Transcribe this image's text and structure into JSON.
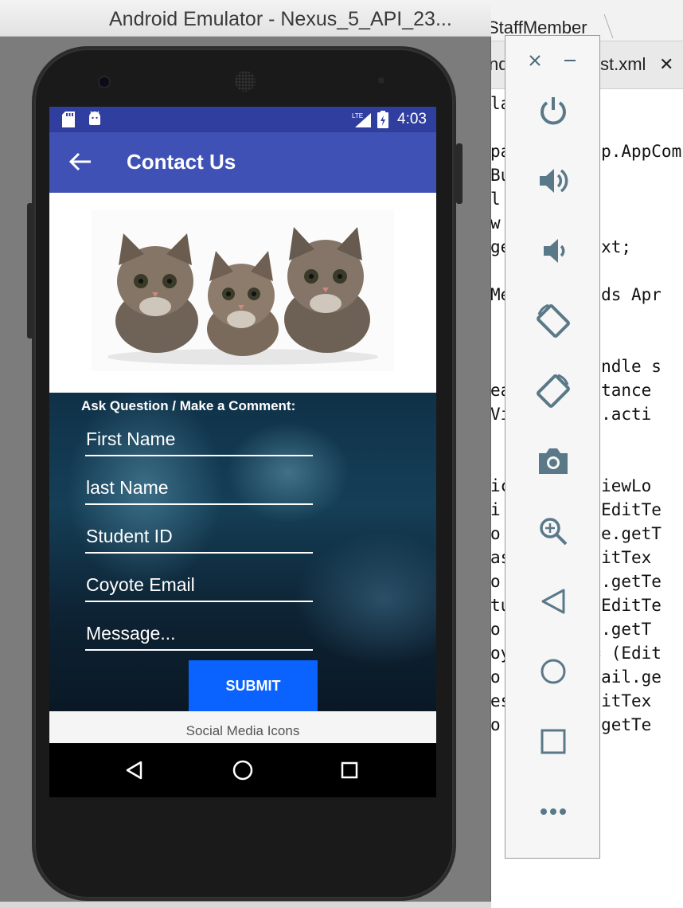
{
  "emulator": {
    "window_title": "Android Emulator - Nexus_5_API_23..."
  },
  "ide": {
    "breadcrumb": "StaffMember",
    "tabs": [
      {
        "label": "ndi"
      },
      {
        "label": "st.xml"
      }
    ],
    "code_lines": [
      "la",
      "pa         p.AppCom",
      "Bu",
      "l",
      "w",
      "ge        ext;",
      "Me      tends Apr",
      "  c      Bundle s",
      "ea      Instance",
      "Vi      out.acti",
      "ic      w viewLo",
      "i       = (EditTe",
      "o'      Name.getT",
      "as      (EditTex",
      "o'      ame.getTe",
      "tu      = (EditTe",
      "o'      tID.getT",
      "oy      . = (Edit",
      "o'      eEmail.ge",
      "es      (EditTex",
      "o'      es.getTe"
    ]
  },
  "app": {
    "status_bar": {
      "time": "4:03",
      "network": "LTE"
    },
    "toolbar": {
      "title": "Contact Us"
    },
    "form": {
      "heading": "Ask Question / Make a Comment:",
      "fields": [
        {
          "label": "First Name"
        },
        {
          "label": "last Name"
        },
        {
          "label": "Student ID"
        },
        {
          "label": "Coyote Email"
        },
        {
          "label": "Message..."
        }
      ],
      "submit_label": "SUBMIT"
    },
    "footer": {
      "social_label": "Social Media Icons"
    }
  },
  "colors": {
    "status_bar": "#303f9f",
    "app_bar": "#3f51b5",
    "submit_button": "#0a62ff"
  },
  "control_panel": {
    "icons": [
      "close-icon",
      "minimize-icon",
      "power-icon",
      "volume-up-icon",
      "volume-down-icon",
      "rotate-left-icon",
      "rotate-right-icon",
      "camera-icon",
      "zoom-icon",
      "back-icon",
      "home-icon",
      "overview-icon",
      "more-icon"
    ]
  }
}
